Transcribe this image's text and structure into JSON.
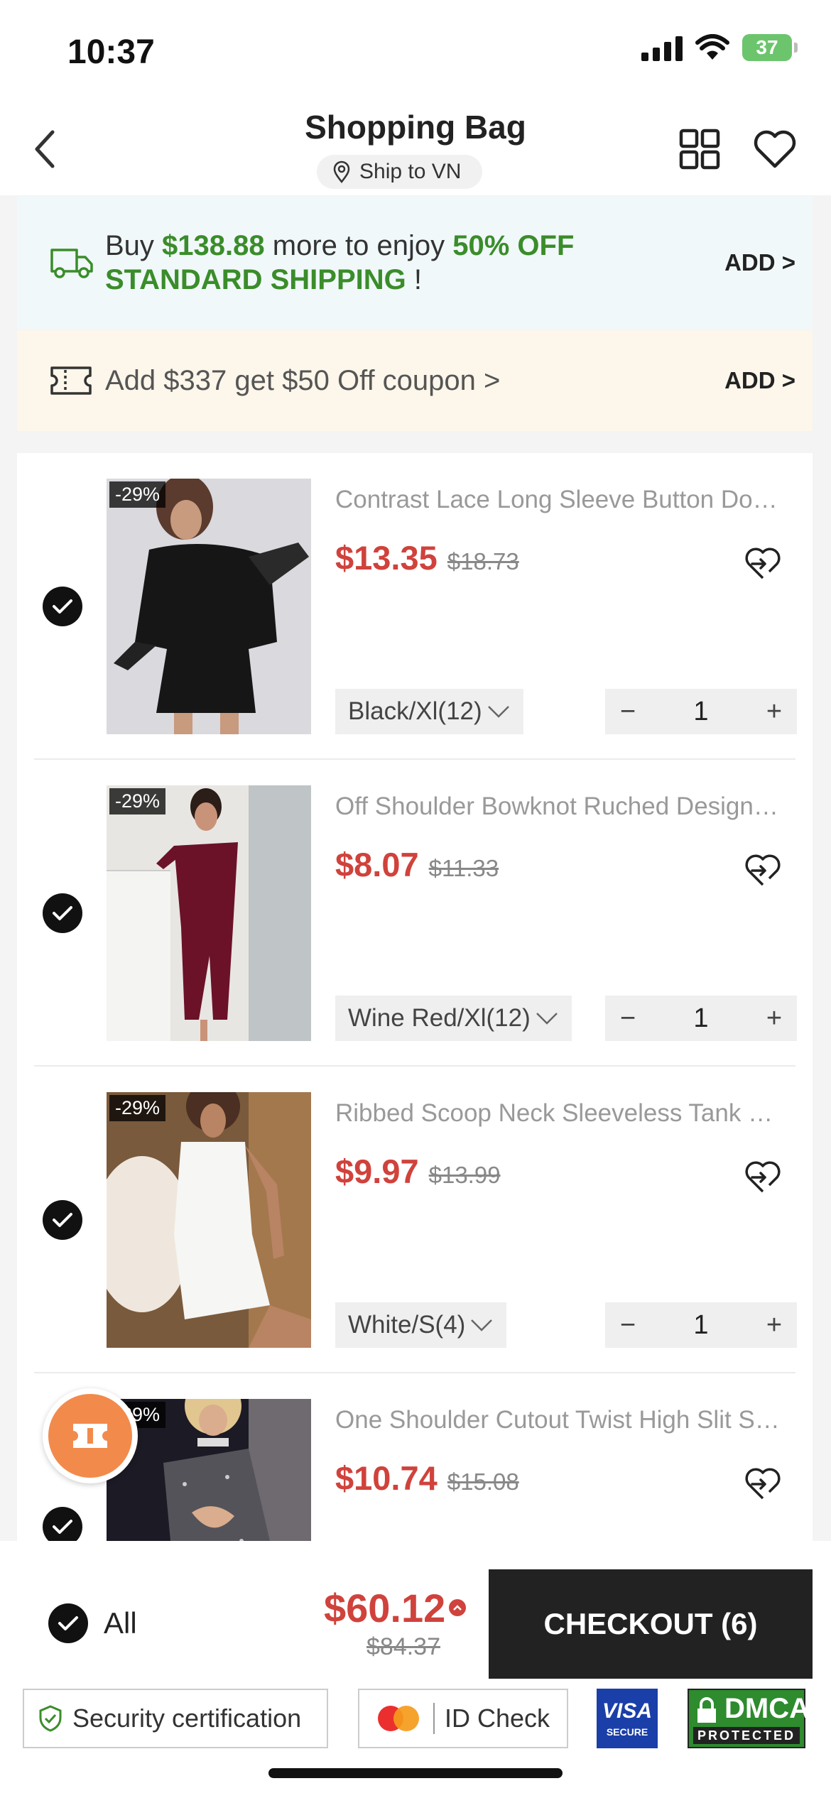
{
  "status": {
    "time": "10:37",
    "battery": "37"
  },
  "header": {
    "title": "Shopping Bag",
    "ship_to": "Ship to VN"
  },
  "banner_shipping": {
    "prefix": "Buy ",
    "amount": "$138.88",
    "middle": " more to enjoy ",
    "highlight": "50% OFF STANDARD SHIPPING",
    "suffix": " !",
    "action": "ADD >"
  },
  "banner_coupon": {
    "text": "Add $337 get $50 Off coupon >",
    "action": "ADD >"
  },
  "items": [
    {
      "discount": "-29%",
      "title": "Contrast Lace Long Sleeve Button Dow…",
      "price": "$13.35",
      "original_price": "$18.73",
      "variant": "Black/Xl(12)",
      "quantity": "1",
      "qty_minus": "−",
      "qty_plus": "+"
    },
    {
      "discount": "-29%",
      "title": "Off Shoulder Bowknot Ruched Design…",
      "price": "$8.07",
      "original_price": "$11.33",
      "variant": "Wine Red/Xl(12)",
      "quantity": "1",
      "qty_minus": "−",
      "qty_plus": "+"
    },
    {
      "discount": "-29%",
      "title": "Ribbed Scoop Neck Sleeveless Tank Dr…",
      "price": "$9.97",
      "original_price": "$13.99",
      "variant": "White/S(4)",
      "quantity": "1",
      "qty_minus": "−",
      "qty_plus": "+"
    },
    {
      "discount": "-29%",
      "title": "One Shoulder Cutout Twist High Slit Se…",
      "price": "$10.74",
      "original_price": "$15.08"
    }
  ],
  "footer": {
    "select_all": "All",
    "total": "$60.12",
    "total_original": "$84.37",
    "checkout": "CHECKOUT (6)",
    "security": "Security certification",
    "id_check": "ID Check",
    "visa_brand": "VISA",
    "visa_sub": "SECURE",
    "dmca": "DMCA",
    "dmca_sub": "PROTECTED"
  },
  "colors": {
    "price_red": "#d0423c",
    "promo_green": "#3a8d2a",
    "checkout_bg": "#222222",
    "coupon_orange": "#f28a4c"
  }
}
